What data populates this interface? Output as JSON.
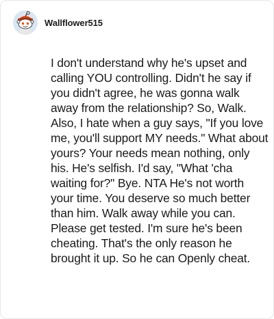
{
  "comment": {
    "username": "Wallflower515",
    "avatar_icon": "reddit-snoo-avatar-icon",
    "text": "I don't understand why he's upset and calling YOU controlling. Didn't he say if you didn't agree, he was gonna walk away from the relationship? So, Walk. Also, I hate when a guy says, \"If you love me, you'll support MY needs.\" What about yours? Your needs mean nothing, only his. He's selfish. I'd say, \"What 'cha waiting for?\" Bye. NTA He's not worth your time. You deserve so much better than him. Walk away while you can. Please get tested. I'm sure he's been cheating. That's the only reason he brought it up. So he can Openly cheat."
  }
}
